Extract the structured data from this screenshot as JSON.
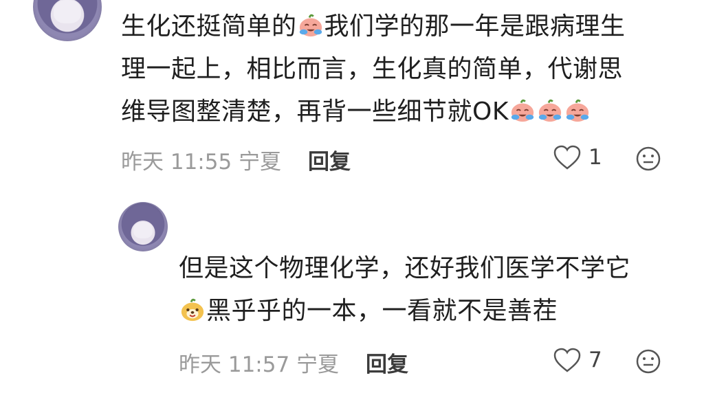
{
  "comments": [
    {
      "lines": [
        [
          "生化还挺简单的",
          "emoji:cry",
          "我们学的那一年是跟病理生"
        ],
        [
          "理一起上，相比而言，生化真的简单，代谢思"
        ],
        [
          "维导图整清楚，再背一些细节就OK",
          "emoji:cry",
          "emoji:cry",
          "emoji:cry"
        ]
      ],
      "time": "昨天 11:55",
      "location": "宁夏",
      "reply_label": "回复",
      "likes": "1"
    },
    {
      "lines": [
        [
          "但是这个物理化学，还好我们医学不学它"
        ],
        [
          "emoji:dog",
          "黑乎乎的一本，一看就不是善茬"
        ]
      ],
      "time": "昨天 11:57",
      "location": "宁夏",
      "reply_label": "回复",
      "likes": "7"
    }
  ],
  "colors": {
    "text": "#1f1f1f",
    "meta": "#9a9a9a",
    "emoji_cry_face": "#f6a79a",
    "emoji_tears": "#5aa9ea",
    "emoji_dog": "#f3c24f"
  },
  "icons": [
    "heart-outline-icon",
    "neutral-face-icon"
  ]
}
